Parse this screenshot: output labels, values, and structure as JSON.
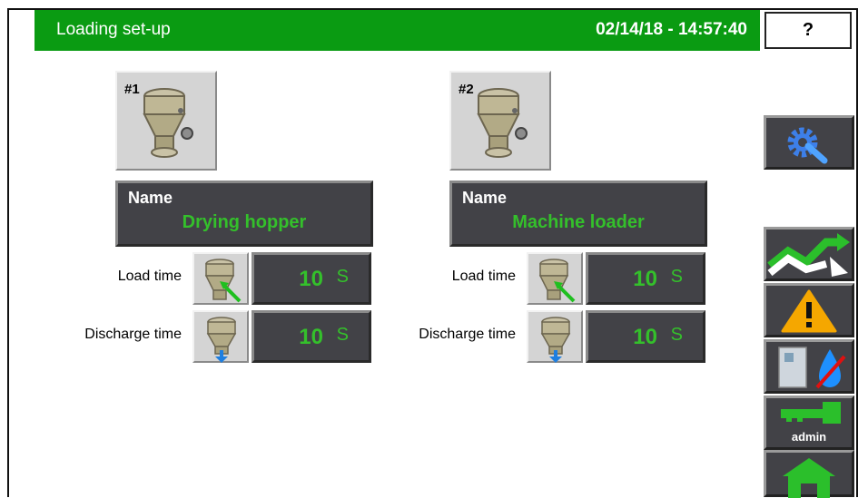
{
  "header": {
    "title": "Loading set-up",
    "datetime": "02/14/18 - 14:57:40",
    "help_label": "?"
  },
  "loaders": [
    {
      "number": "#1",
      "name_label": "Name",
      "name": "Drying hopper",
      "load_time_label": "Load time",
      "load_time": "10",
      "load_unit": "S",
      "discharge_time_label": "Discharge time",
      "discharge_time": "10",
      "discharge_unit": "S"
    },
    {
      "number": "#2",
      "name_label": "Name",
      "name": "Machine loader",
      "load_time_label": "Load time",
      "load_time": "10",
      "load_unit": "S",
      "discharge_time_label": "Discharge time",
      "discharge_time": "10",
      "discharge_unit": "S"
    }
  ],
  "sidebar": {
    "settings_icon": "gear-wrench-icon",
    "trend_icon": "trend-chart-icon",
    "alarm_icon": "warning-icon",
    "dryer_icon": "dryer-water-icon",
    "user_label": "admin",
    "home_icon": "home-icon"
  },
  "colors": {
    "header_bg": "#0a9b12",
    "value_green": "#34c02b",
    "panel_dark": "#424247",
    "button_grey": "#d4d4d4"
  }
}
